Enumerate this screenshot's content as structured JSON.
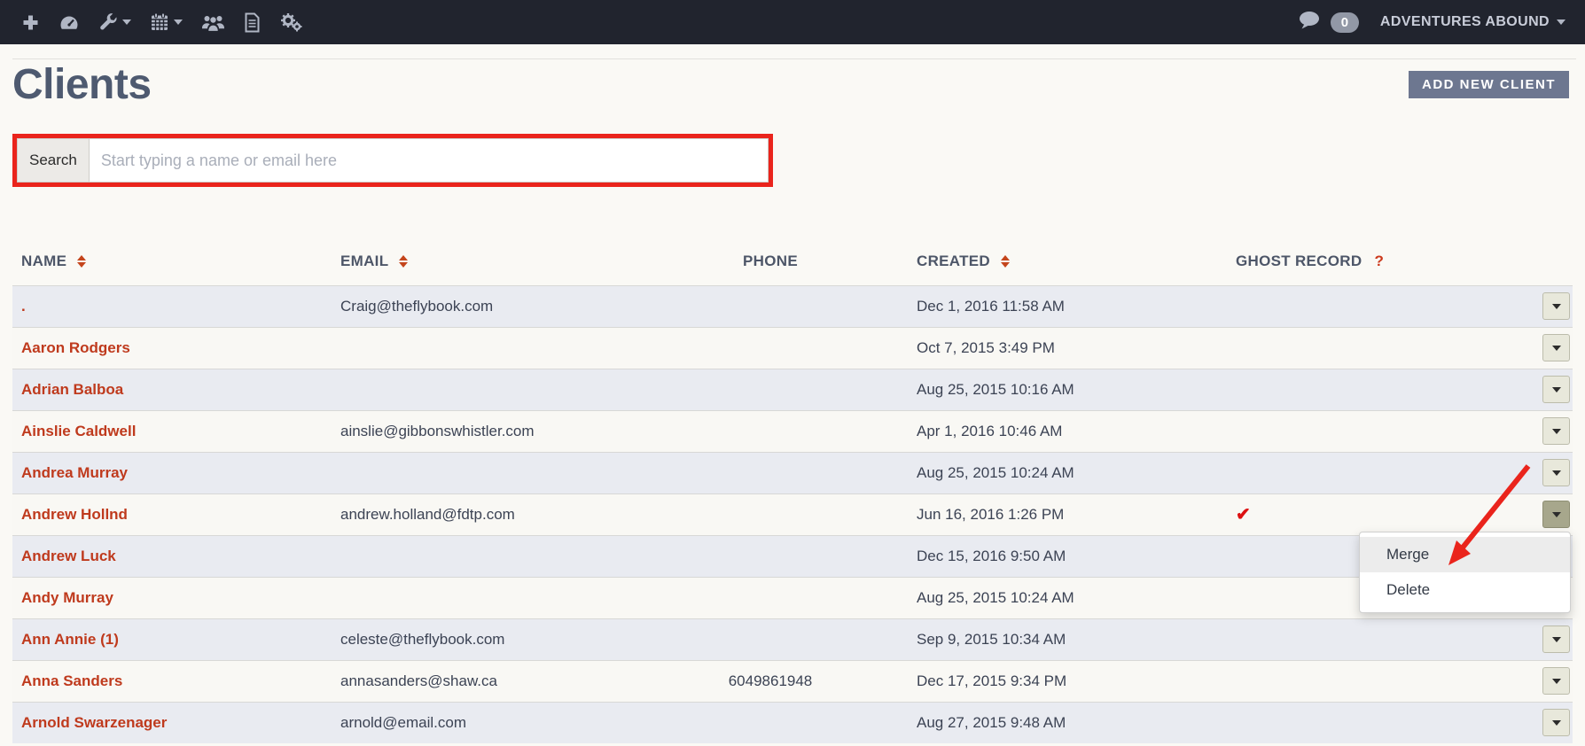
{
  "navbar": {
    "icons": [
      "add-icon",
      "dashboard-icon",
      "tools-icon",
      "calendar-icon",
      "clients-icon",
      "documents-icon",
      "settings-icon"
    ],
    "chat_icon": "chat-icon",
    "unread_count": "0",
    "account_name": "ADVENTURES ABOUND"
  },
  "header": {
    "title": "Clients",
    "add_button_label": "ADD NEW CLIENT"
  },
  "search": {
    "label": "Search",
    "placeholder": "Start typing a name or email here",
    "value": ""
  },
  "table": {
    "columns": [
      {
        "label": "NAME",
        "sortable": true
      },
      {
        "label": "EMAIL",
        "sortable": true
      },
      {
        "label": "PHONE",
        "sortable": false
      },
      {
        "label": "CREATED",
        "sortable": true
      },
      {
        "label": "GHOST RECORD",
        "sortable": false,
        "help": "?"
      },
      {
        "label": "",
        "sortable": false
      }
    ],
    "rows": [
      {
        "name": ".",
        "email": "Craig@theflybook.com",
        "phone": "",
        "created": "Dec 1, 2016 11:58 AM",
        "ghost": ""
      },
      {
        "name": "Aaron Rodgers",
        "email": "",
        "phone": "",
        "created": "Oct 7, 2015 3:49 PM",
        "ghost": ""
      },
      {
        "name": "Adrian Balboa",
        "email": "",
        "phone": "",
        "created": "Aug 25, 2015 10:16 AM",
        "ghost": ""
      },
      {
        "name": "Ainslie Caldwell",
        "email": "ainslie@gibbonswhistler.com",
        "phone": "",
        "created": "Apr 1, 2016 10:46 AM",
        "ghost": ""
      },
      {
        "name": "Andrea Murray",
        "email": "",
        "phone": "",
        "created": "Aug 25, 2015 10:24 AM",
        "ghost": ""
      },
      {
        "name": "Andrew Hollnd",
        "email": "andrew.holland@fdtp.com",
        "phone": "",
        "created": "Jun 16, 2016 1:26 PM",
        "ghost": "✔"
      },
      {
        "name": "Andrew Luck",
        "email": "",
        "phone": "",
        "created": "Dec 15, 2016 9:50 AM",
        "ghost": ""
      },
      {
        "name": "Andy Murray",
        "email": "",
        "phone": "",
        "created": "Aug 25, 2015 10:24 AM",
        "ghost": ""
      },
      {
        "name": "Ann Annie (1)",
        "email": "celeste@theflybook.com",
        "phone": "",
        "created": "Sep 9, 2015 10:34 AM",
        "ghost": ""
      },
      {
        "name": "Anna Sanders",
        "email": "annasanders@shaw.ca",
        "phone": "6049861948",
        "created": "Dec 17, 2015 9:34 PM",
        "ghost": ""
      },
      {
        "name": "Arnold Swarzenager",
        "email": "arnold@email.com",
        "phone": "",
        "created": "Aug 27, 2015 9:48 AM",
        "ghost": ""
      }
    ]
  },
  "context_menu": {
    "items": [
      {
        "label": "Merge",
        "highlighted": true
      },
      {
        "label": "Delete",
        "highlighted": false
      }
    ]
  },
  "annotations": {
    "search_highlight": "red rectangle around search box",
    "arrow": "red arrow pointing at Merge menu item"
  },
  "colors": {
    "nav_bg": "#21242e",
    "annotation_red": "#ea241c",
    "client_link_red": "#bf3a1d",
    "sort_arrow_orange": "#c4451c",
    "ghost_check_red": "#dd1111",
    "add_button_bg": "#6d7790",
    "row_stripe": "#e9ebf1"
  }
}
